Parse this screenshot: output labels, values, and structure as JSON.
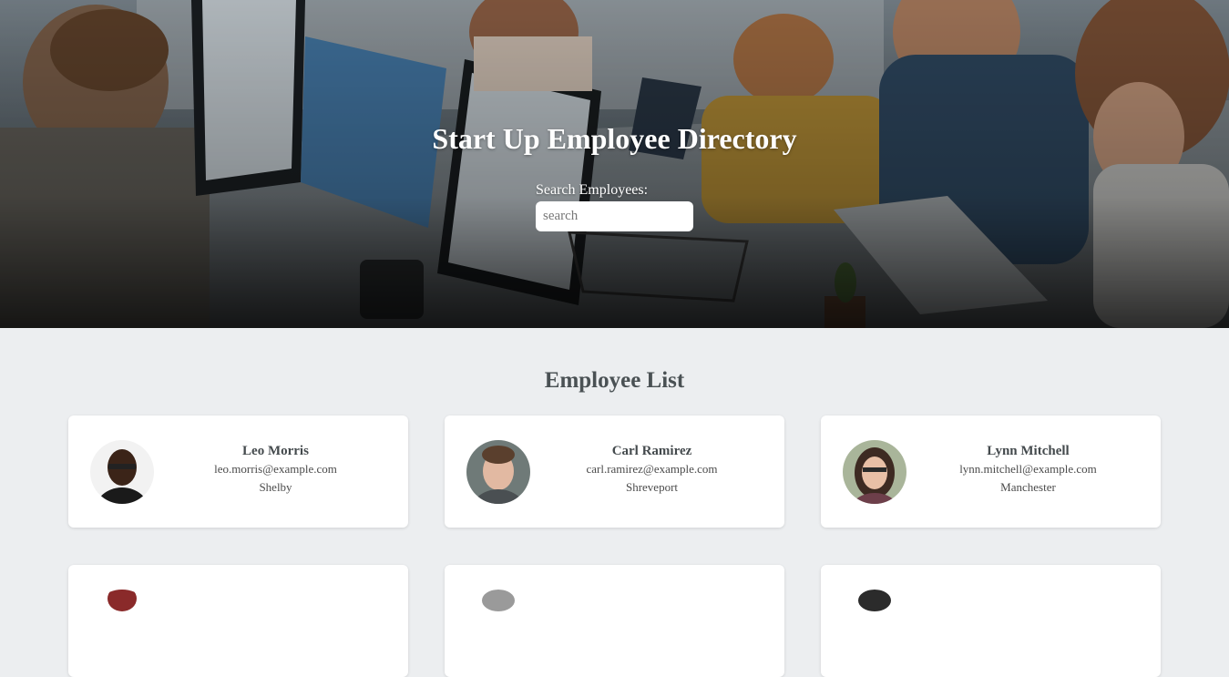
{
  "header": {
    "title": "Start Up Employee Directory",
    "search_label": "Search Employees:",
    "search_placeholder": "search",
    "search_value": ""
  },
  "main": {
    "title": "Employee List",
    "employees": [
      {
        "name": "Leo Morris",
        "email": "leo.morris@example.com",
        "city": "Shelby"
      },
      {
        "name": "Carl Ramirez",
        "email": "carl.ramirez@example.com",
        "city": "Shreveport"
      },
      {
        "name": "Lynn Mitchell",
        "email": "lynn.mitchell@example.com",
        "city": "Manchester"
      },
      {
        "name": "",
        "email": "",
        "city": ""
      },
      {
        "name": "",
        "email": "",
        "city": ""
      },
      {
        "name": "",
        "email": "",
        "city": ""
      }
    ]
  },
  "colors": {
    "page_background": "#eceef0",
    "card_background": "#ffffff",
    "heading_text": "#4a5154",
    "hero_text": "#ffffff"
  }
}
